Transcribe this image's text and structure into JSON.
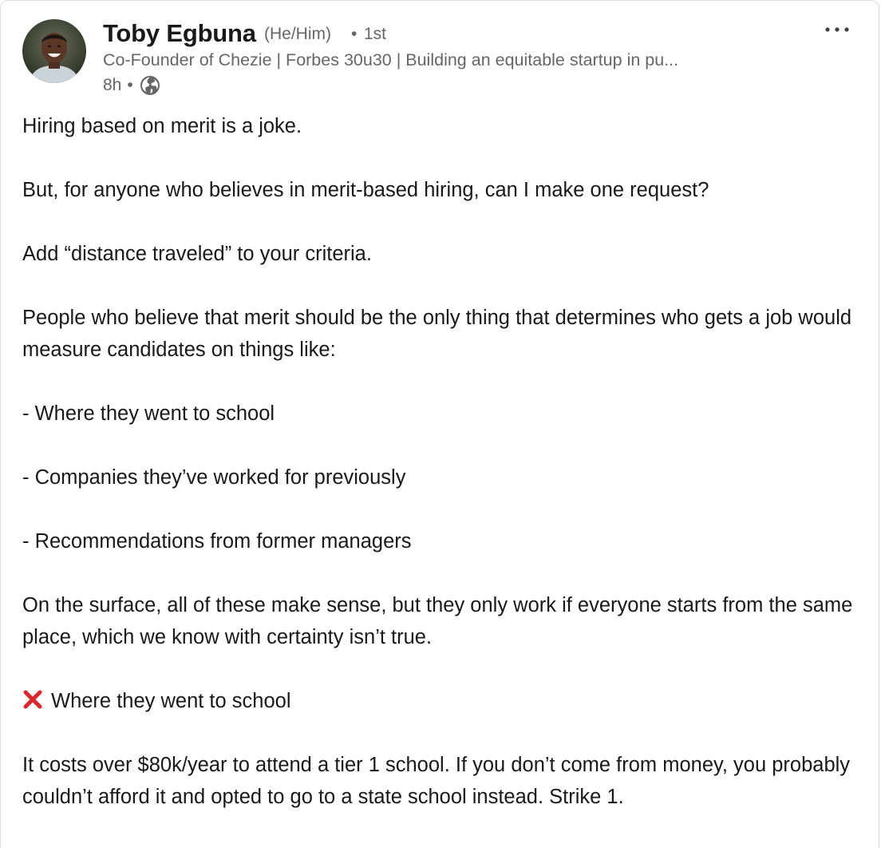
{
  "author": {
    "name": "Toby Egbuna",
    "pronouns": "(He/Him)",
    "separator": "•",
    "degree": "1st",
    "headline": "Co-Founder of Chezie | Forbes 30u30 | Building an equitable startup in pu...",
    "time": "8h",
    "time_separator": "•",
    "visibility_icon": "globe-icon",
    "avatar_icon": "profile-photo"
  },
  "more_icon": "more-horizontal-icon",
  "post": {
    "p1": "Hiring based on merit is a joke.",
    "p2": "But, for anyone who believes in merit-based hiring, can I make one request?",
    "p3": "Add “distance traveled” to your criteria.",
    "p4": "People who believe that merit should be the only thing that determines who gets a job would measure candidates on things like:",
    "p5": "- Where they went to school",
    "p6": "- Companies they’ve worked for previously",
    "p7": "- Recommendations from former managers",
    "p8": "On the surface, all of these make sense, but they only work if everyone starts from the same place, which we know with certainty isn’t true.",
    "p9_icon": "cross-mark-icon",
    "p9": "Where they went to school",
    "p10": "It costs over $80k/year to attend a tier 1 school. If you don’t come from money, you probably couldn’t afford it and opted to go to a state school instead. Strike 1."
  },
  "colors": {
    "text": "#191919",
    "secondary": "#666666",
    "cross": "#e0242b"
  }
}
